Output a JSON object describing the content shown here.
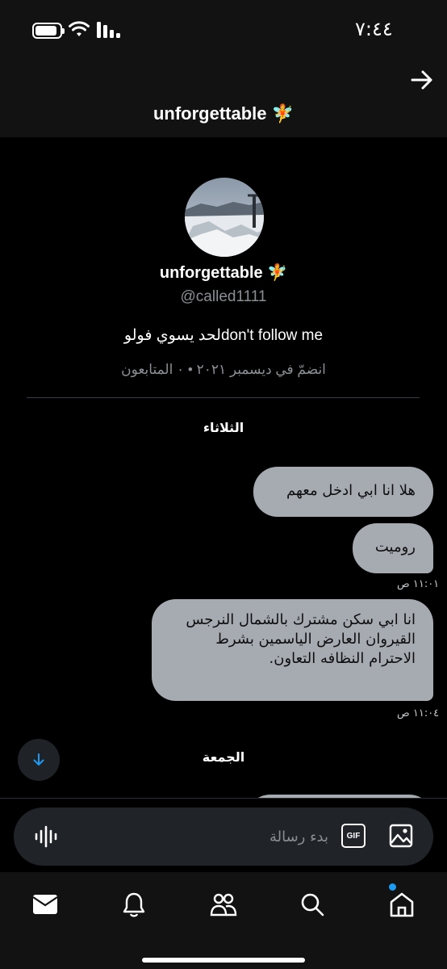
{
  "status_bar": {
    "time": "٧:٤٤"
  },
  "header": {
    "title": "unforgettable 🧚"
  },
  "profile": {
    "name": "unforgettable 🧚",
    "handle": "@called1111",
    "bio": "لحد يسوي فولوdon't follow me",
    "meta": "انضمّ في ديسمبر ٢٠٢١ • ٠ المتابعون"
  },
  "conversation": {
    "day_1": "الثلاثاء",
    "messages": [
      {
        "text": "هلا انا ابي ادخل معهم"
      },
      {
        "text": "روميت"
      },
      {
        "text": "انا ابي سكن مشترك بالشمال النرجس القيروان العارض الياسمين بشرط الاحترام النظافه التعاون."
      }
    ],
    "timestamps": [
      "١١:٠١ ص",
      "١١:٠٤ ص"
    ],
    "day_2": "الجمعة"
  },
  "composer": {
    "placeholder": "بدء رسالة",
    "gif_label": "GIF"
  },
  "icons": {
    "back": "arrow-right-icon",
    "voice": "voice-waveform-icon",
    "image": "image-icon",
    "scroll": "arrow-down-icon",
    "tabs": [
      "mail-icon",
      "bell-icon",
      "people-icon",
      "search-icon",
      "home-icon"
    ]
  },
  "colors": {
    "accent": "#1d9bf0",
    "bubble": "#a6abb2",
    "background": "#000000",
    "secondary_text": "#8b8f94"
  }
}
